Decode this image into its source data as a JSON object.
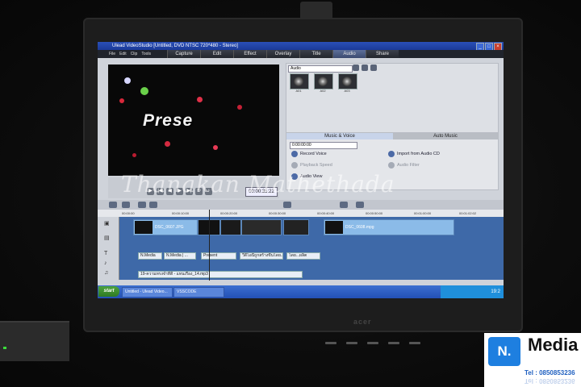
{
  "app": {
    "title": "Ulead VideoStudio [Untitled, DVD NTSC 720*480 - Stereo]",
    "menu": [
      "File",
      "Edit",
      "Clip",
      "Tools"
    ],
    "steps": [
      "Capture",
      "Edit",
      "Effect",
      "Overlay",
      "Title",
      "Audio",
      "Share"
    ],
    "active_step": "Audio"
  },
  "preview": {
    "overlay_text": "Prese",
    "timecode": "00:00:35:22"
  },
  "library": {
    "category": "Audio",
    "items": [
      "A01",
      "A02",
      "A03"
    ]
  },
  "options": {
    "tabs": [
      "Music & Voice",
      "Auto Music"
    ],
    "time_field": "0:00:00:00",
    "items": [
      {
        "label": "Record Voice",
        "enabled": true
      },
      {
        "label": "Import from Audio CD",
        "enabled": true
      },
      {
        "label": "Playback Speed",
        "enabled": false
      },
      {
        "label": "Audio Filter",
        "enabled": false
      },
      {
        "label": "Audio View",
        "enabled": true
      }
    ]
  },
  "timeline": {
    "ruler": [
      "00:00:00",
      "00:00:10:00",
      "00:00:20:00",
      "00:00:30:00",
      "00:00:40:00",
      "00:00:50:00",
      "00:01:00:00",
      "00:01:02:02"
    ],
    "video_clips": [
      "DSC_0607.JPG",
      "DSC_0608.mpg"
    ],
    "title_clips": [
      "N.Media",
      "N.Media | ...",
      "Present",
      "วีดีโอนี้ถูกสร้างขึ้นโดย...",
      "โดย...ผลิต"
    ],
    "music_clip": "19-ความทรงจำที่ดี - แทนเรื่อง_14.mp3"
  },
  "taskbar": {
    "start": "start",
    "tasks": [
      "Untitled - Ulead Video...",
      "VSSCODE"
    ],
    "clock": "19:2"
  },
  "monitor": {
    "brand": "acer"
  },
  "watermark": "Thanakan Mathethada",
  "logo": {
    "badge": "N.",
    "name": "Media",
    "phone": "Tel : 0850853236"
  },
  "colors": {
    "timeline_track": "#3e69a8",
    "clip": "#8bbbe8",
    "titlebar": "#2a4fb7",
    "taskbar": "#2350b5",
    "logo_blue": "#1e7fe0"
  }
}
